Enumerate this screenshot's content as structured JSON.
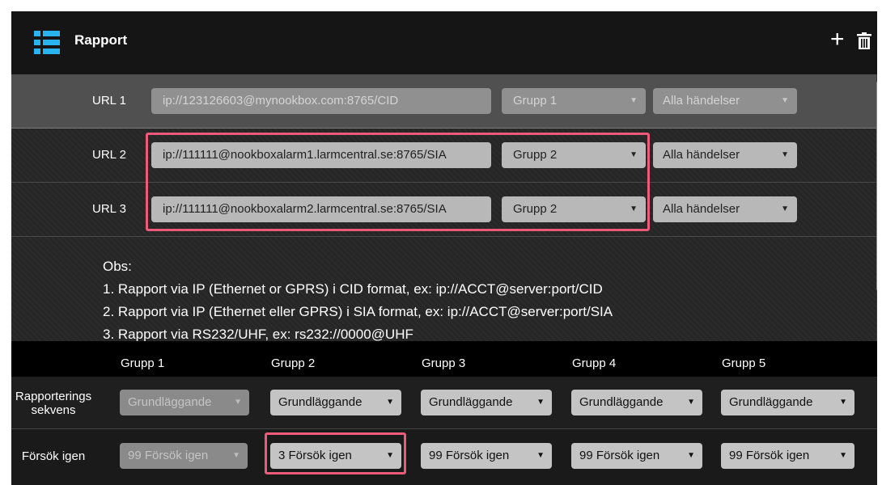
{
  "header": {
    "title": "Rapport",
    "icons": [
      "list-icon",
      "plus-icon",
      "trash-icon"
    ]
  },
  "urls": [
    {
      "label": "URL 1",
      "value": "ip://123126603@mynookbox.com:8765/CID",
      "group": "Grupp 1",
      "events": "Alla händelser",
      "disabled": true
    },
    {
      "label": "URL 2",
      "value": "ip://111111@nookboxalarm1.larmcentral.se:8765/SIA",
      "group": "Grupp 2",
      "events": "Alla händelser",
      "disabled": false
    },
    {
      "label": "URL 3",
      "value": "ip://111111@nookboxalarm2.larmcentral.se:8765/SIA",
      "group": "Grupp 2",
      "events": "Alla händelser",
      "disabled": false
    }
  ],
  "notes": {
    "heading": "Obs:",
    "lines": [
      "1. Rapport via IP (Ethernet or GPRS) i CID format, ex: ip://ACCT@server:port/CID",
      "2. Rapport via IP (Ethernet eller GPRS) i SIA format, ex: ip://ACCT@server:port/SIA",
      "3. Rapport via RS232/UHF, ex: rs232://0000@UHF"
    ]
  },
  "groups": {
    "headers": [
      "Grupp 1",
      "Grupp 2",
      "Grupp 3",
      "Grupp 4",
      "Grupp 5"
    ],
    "rows": [
      {
        "label": "Rapporterings sekvens",
        "values": [
          "Grundläggande",
          "Grundläggande",
          "Grundläggande",
          "Grundläggande",
          "Grundläggande"
        ]
      },
      {
        "label": "Försök igen",
        "values": [
          "99 Försök igen",
          "3 Försök igen",
          "99 Försök igen",
          "99 Försök igen",
          "99 Försök igen"
        ]
      }
    ]
  },
  "colors": {
    "accent": "#2ab4ef",
    "highlight": "#ee5a79"
  }
}
